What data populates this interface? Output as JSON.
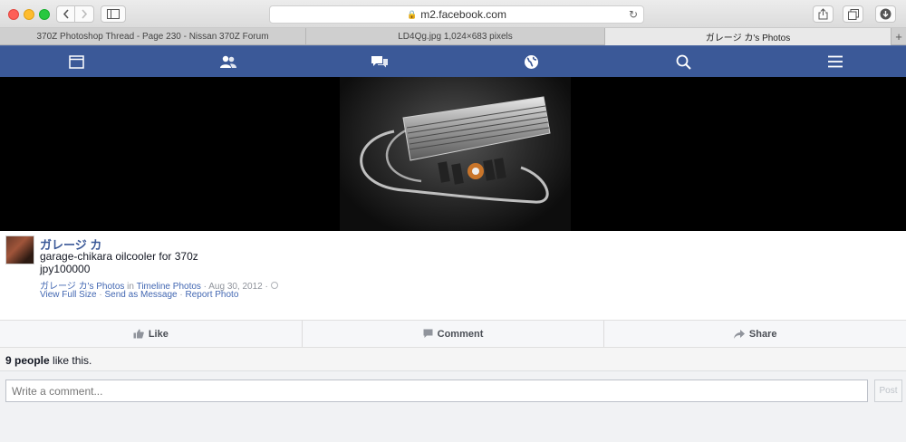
{
  "browser": {
    "url": "m2.facebook.com",
    "tabs": [
      {
        "label": "370Z Photoshop Thread - Page 230 - Nissan 370Z Forum",
        "active": false
      },
      {
        "label": "LD4Qg.jpg 1,024×683 pixels",
        "active": false
      },
      {
        "label": "ガレージ カ's Photos",
        "active": true
      }
    ],
    "new_tab": "+"
  },
  "nav": {
    "icons": [
      "news-feed-icon",
      "friends-icon",
      "messages-icon",
      "notifications-globe-icon",
      "search-icon",
      "menu-icon"
    ],
    "color": "#3b5998"
  },
  "post": {
    "author": "ガレージ カ",
    "caption_line1": "garage-chikara oilcooler for 370z",
    "caption_line2": "jpy100000",
    "album_owner": "ガレージ カ's Photos",
    "in_word": " in ",
    "album": "Timeline Photos",
    "date": " · Aug 30, 2012 · ",
    "view_full_size": "View Full Size",
    "sep": " · ",
    "send_message": "Send as Message",
    "report_photo": "Report Photo"
  },
  "actions": {
    "like": "Like",
    "comment": "Comment",
    "share": "Share"
  },
  "likes": {
    "count": "9 people",
    "suffix": " like this."
  },
  "comment": {
    "placeholder": "Write a comment...",
    "post_label": "Post"
  }
}
